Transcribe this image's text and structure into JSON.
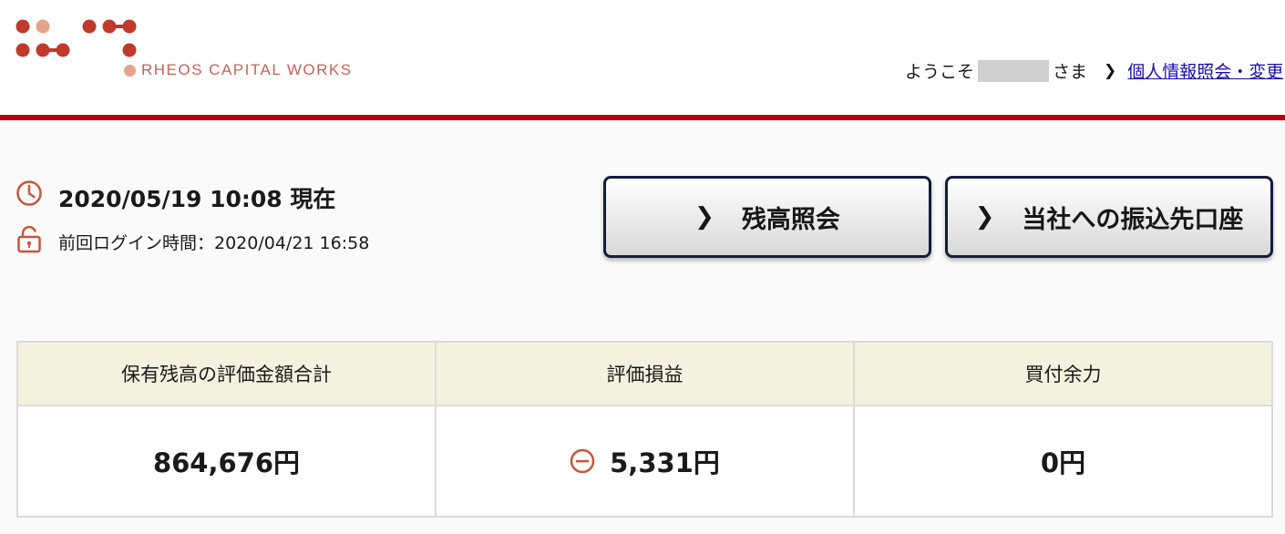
{
  "header": {
    "brand": "RHEOS CAPITAL WORKS",
    "welcome_prefix": "ようこそ",
    "welcome_suffix": "さま",
    "profile_link": "個人情報照会・変更"
  },
  "info": {
    "datetime": "2020/05/19 10:08 現在",
    "last_login": "前回ログイン時間：2020/04/21 16:58"
  },
  "buttons": {
    "balance": "残高照会",
    "transfer": "当社への振込先口座"
  },
  "summary": {
    "headers": [
      "保有残高の評価金額合計",
      "評価損益",
      "買付余力"
    ],
    "values": [
      "864,676円",
      "5,331円",
      "0円"
    ]
  },
  "icons": [
    "logo-mark",
    "clock-icon",
    "unlock-icon",
    "chevron-right-icon",
    "minus-circle-icon"
  ],
  "colors": {
    "accent_red": "#b4000f",
    "logo_red": "#c0392b",
    "logo_salmon": "#e4a48a",
    "button_border": "#131c3e",
    "table_header_bg": "#f4f2df"
  }
}
